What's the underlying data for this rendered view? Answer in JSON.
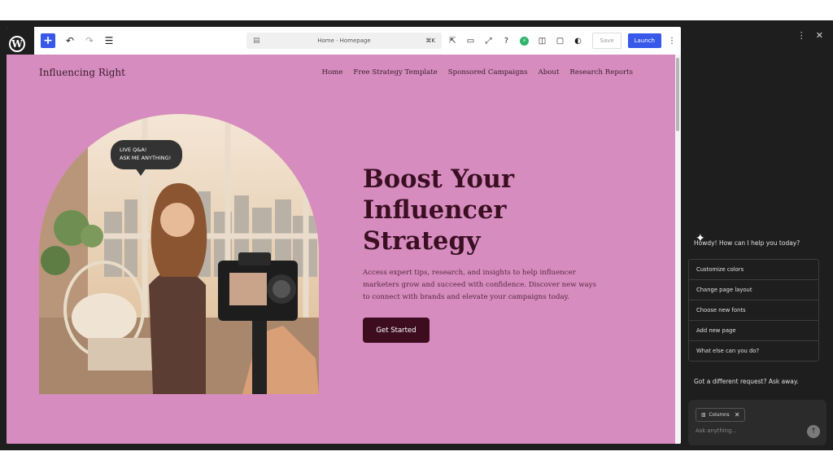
{
  "toolbar": {
    "doc_title": "Home · Homepage",
    "shortcut": "⌘K",
    "save_label": "Save",
    "launch_label": "Launch"
  },
  "site": {
    "title": "Influencing Right",
    "nav": [
      "Home",
      "Free Strategy Template",
      "Sponsored Campaigns",
      "About",
      "Research Reports"
    ]
  },
  "hero": {
    "bubble_line1": "LIVE Q&A!",
    "bubble_line2": "ASK ME ANYTHING!",
    "headline_1": "Boost Your",
    "headline_2": "Influencer",
    "headline_3": "Strategy",
    "description": "Access expert tips, research, and insights to help influencer marketers grow and succeed with confidence. Discover new ways to connect with brands and elevate your campaigns today.",
    "cta_label": "Get Started"
  },
  "assistant": {
    "greeting": "Howdy! How can I help you today?",
    "suggestions": [
      "Customize colors",
      "Change page layout",
      "Choose new fonts",
      "Add new page",
      "What else can you do?"
    ],
    "different_request": "Got a different request? Ask away.",
    "chip_label": "Columns",
    "input_placeholder": "Ask anything..."
  },
  "colors": {
    "canvas_bg": "#d68cbf",
    "accent_blue": "#3858e9",
    "cta_bg": "#3d0d1f",
    "panel_bg": "#1e1e1e"
  }
}
